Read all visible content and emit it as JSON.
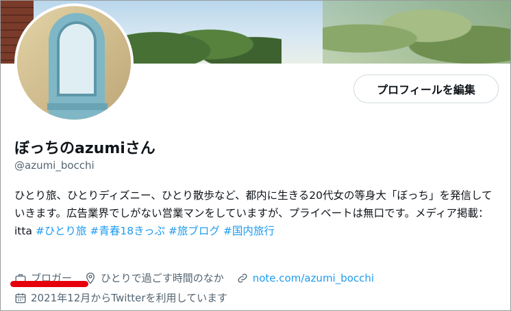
{
  "profile": {
    "edit_button": "プロフィールを編集",
    "display_name": "ぼっちのazumiさん",
    "handle": "@azumi_bocchi",
    "bio_text_1": "ひとり旅、ひとりディズニー、ひとり散歩など、都内に生きる20代女の等身大「ぼっち」を発信していきます。広告業界でしがない営業マンをしていますが、プライベートは無口です。メディア掲載：itta",
    "hashtags": [
      "#ひとり旅",
      "#青春18きっぷ",
      "#旅ブログ",
      "#国内旅行"
    ],
    "category": "ブロガー",
    "location": "ひとりで過ごす時間のなか",
    "website": "note.com/azumi_bocchi",
    "joined": "2021年12月からTwitterを利用しています"
  },
  "icons": {
    "category": "briefcase-icon",
    "location": "location-pin-icon",
    "website": "link-icon",
    "joined": "calendar-icon"
  },
  "colors": {
    "accent": "#1d9bf0",
    "secondary_text": "#536471",
    "primary_text": "#0f1419",
    "annotation": "#e5000b"
  }
}
